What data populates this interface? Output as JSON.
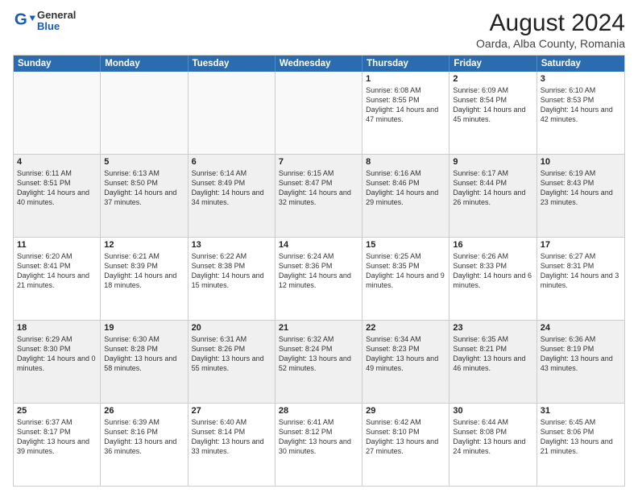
{
  "header": {
    "logo": {
      "general": "General",
      "blue": "Blue"
    },
    "title": "August 2024",
    "subtitle": "Oarda, Alba County, Romania"
  },
  "weekdays": [
    "Sunday",
    "Monday",
    "Tuesday",
    "Wednesday",
    "Thursday",
    "Friday",
    "Saturday"
  ],
  "rows": [
    [
      {
        "day": "",
        "text": ""
      },
      {
        "day": "",
        "text": ""
      },
      {
        "day": "",
        "text": ""
      },
      {
        "day": "",
        "text": ""
      },
      {
        "day": "1",
        "text": "Sunrise: 6:08 AM\nSunset: 8:55 PM\nDaylight: 14 hours and 47 minutes."
      },
      {
        "day": "2",
        "text": "Sunrise: 6:09 AM\nSunset: 8:54 PM\nDaylight: 14 hours and 45 minutes."
      },
      {
        "day": "3",
        "text": "Sunrise: 6:10 AM\nSunset: 8:53 PM\nDaylight: 14 hours and 42 minutes."
      }
    ],
    [
      {
        "day": "4",
        "text": "Sunrise: 6:11 AM\nSunset: 8:51 PM\nDaylight: 14 hours and 40 minutes."
      },
      {
        "day": "5",
        "text": "Sunrise: 6:13 AM\nSunset: 8:50 PM\nDaylight: 14 hours and 37 minutes."
      },
      {
        "day": "6",
        "text": "Sunrise: 6:14 AM\nSunset: 8:49 PM\nDaylight: 14 hours and 34 minutes."
      },
      {
        "day": "7",
        "text": "Sunrise: 6:15 AM\nSunset: 8:47 PM\nDaylight: 14 hours and 32 minutes."
      },
      {
        "day": "8",
        "text": "Sunrise: 6:16 AM\nSunset: 8:46 PM\nDaylight: 14 hours and 29 minutes."
      },
      {
        "day": "9",
        "text": "Sunrise: 6:17 AM\nSunset: 8:44 PM\nDaylight: 14 hours and 26 minutes."
      },
      {
        "day": "10",
        "text": "Sunrise: 6:19 AM\nSunset: 8:43 PM\nDaylight: 14 hours and 23 minutes."
      }
    ],
    [
      {
        "day": "11",
        "text": "Sunrise: 6:20 AM\nSunset: 8:41 PM\nDaylight: 14 hours and 21 minutes."
      },
      {
        "day": "12",
        "text": "Sunrise: 6:21 AM\nSunset: 8:39 PM\nDaylight: 14 hours and 18 minutes."
      },
      {
        "day": "13",
        "text": "Sunrise: 6:22 AM\nSunset: 8:38 PM\nDaylight: 14 hours and 15 minutes."
      },
      {
        "day": "14",
        "text": "Sunrise: 6:24 AM\nSunset: 8:36 PM\nDaylight: 14 hours and 12 minutes."
      },
      {
        "day": "15",
        "text": "Sunrise: 6:25 AM\nSunset: 8:35 PM\nDaylight: 14 hours and 9 minutes."
      },
      {
        "day": "16",
        "text": "Sunrise: 6:26 AM\nSunset: 8:33 PM\nDaylight: 14 hours and 6 minutes."
      },
      {
        "day": "17",
        "text": "Sunrise: 6:27 AM\nSunset: 8:31 PM\nDaylight: 14 hours and 3 minutes."
      }
    ],
    [
      {
        "day": "18",
        "text": "Sunrise: 6:29 AM\nSunset: 8:30 PM\nDaylight: 14 hours and 0 minutes."
      },
      {
        "day": "19",
        "text": "Sunrise: 6:30 AM\nSunset: 8:28 PM\nDaylight: 13 hours and 58 minutes."
      },
      {
        "day": "20",
        "text": "Sunrise: 6:31 AM\nSunset: 8:26 PM\nDaylight: 13 hours and 55 minutes."
      },
      {
        "day": "21",
        "text": "Sunrise: 6:32 AM\nSunset: 8:24 PM\nDaylight: 13 hours and 52 minutes."
      },
      {
        "day": "22",
        "text": "Sunrise: 6:34 AM\nSunset: 8:23 PM\nDaylight: 13 hours and 49 minutes."
      },
      {
        "day": "23",
        "text": "Sunrise: 6:35 AM\nSunset: 8:21 PM\nDaylight: 13 hours and 46 minutes."
      },
      {
        "day": "24",
        "text": "Sunrise: 6:36 AM\nSunset: 8:19 PM\nDaylight: 13 hours and 43 minutes."
      }
    ],
    [
      {
        "day": "25",
        "text": "Sunrise: 6:37 AM\nSunset: 8:17 PM\nDaylight: 13 hours and 39 minutes."
      },
      {
        "day": "26",
        "text": "Sunrise: 6:39 AM\nSunset: 8:16 PM\nDaylight: 13 hours and 36 minutes."
      },
      {
        "day": "27",
        "text": "Sunrise: 6:40 AM\nSunset: 8:14 PM\nDaylight: 13 hours and 33 minutes."
      },
      {
        "day": "28",
        "text": "Sunrise: 6:41 AM\nSunset: 8:12 PM\nDaylight: 13 hours and 30 minutes."
      },
      {
        "day": "29",
        "text": "Sunrise: 6:42 AM\nSunset: 8:10 PM\nDaylight: 13 hours and 27 minutes."
      },
      {
        "day": "30",
        "text": "Sunrise: 6:44 AM\nSunset: 8:08 PM\nDaylight: 13 hours and 24 minutes."
      },
      {
        "day": "31",
        "text": "Sunrise: 6:45 AM\nSunset: 8:06 PM\nDaylight: 13 hours and 21 minutes."
      }
    ]
  ]
}
